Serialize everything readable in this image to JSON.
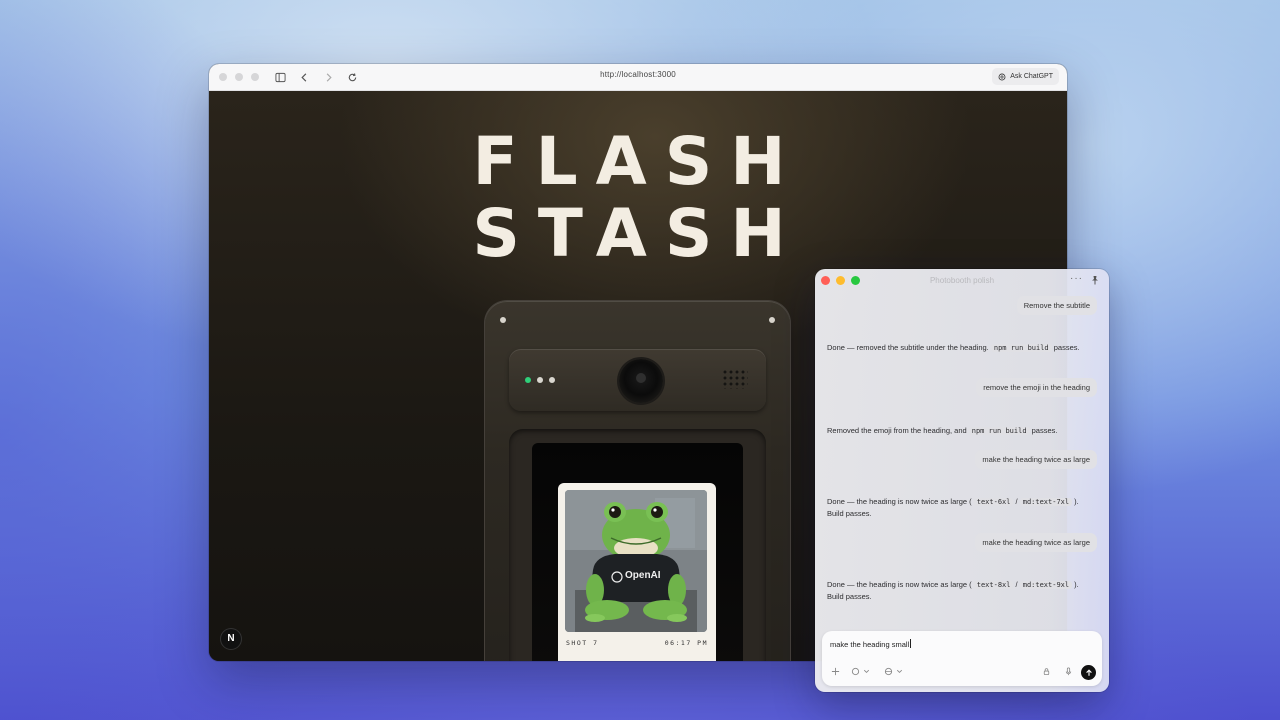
{
  "browser": {
    "url": "http://localhost:3000",
    "ask_label": "Ask ChatGPT"
  },
  "site": {
    "heading_line1": "FLASH",
    "heading_line2": "STASH",
    "shot_label": "SHOT 7",
    "shot_time": "06:17 PM",
    "print_logo_text": "OpenAI",
    "next_badge": "N",
    "led_colors": [
      "#2fcf7a",
      "#d9d6cf",
      "#d9d6cf"
    ]
  },
  "chat": {
    "title": "Photobooth polish",
    "messages": [
      {
        "role": "user",
        "text": "Remove the subtitle"
      },
      {
        "role": "assistant",
        "parts": [
          "Done — removed the subtitle under the heading. ",
          "npm run build",
          " passes."
        ]
      },
      {
        "role": "user",
        "text": "remove the emoji in the heading"
      },
      {
        "role": "assistant",
        "parts": [
          "Removed the emoji from the heading, and ",
          "npm run build",
          " passes."
        ]
      },
      {
        "role": "user",
        "text": "make the heading twice as large"
      },
      {
        "role": "assistant",
        "parts": [
          "Done — the heading is now twice as large ( ",
          "text-6xl",
          " / ",
          "md:text-7xl",
          " ). Build passes."
        ]
      },
      {
        "role": "user",
        "text": "make the heading twice as large"
      },
      {
        "role": "assistant",
        "parts": [
          "Done — the heading is now twice as large ( ",
          "text-8xl",
          " / ",
          "md:text-9xl",
          " ). Build passes."
        ]
      }
    ],
    "composer_value": "make the heading small"
  },
  "colors": {
    "close": "#ff5f57",
    "minimize": "#febc2e",
    "maximize": "#28c840"
  }
}
